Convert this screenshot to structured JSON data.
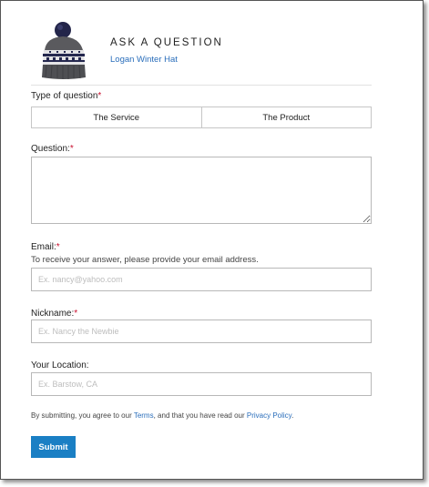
{
  "header": {
    "title": "ASK A QUESTION",
    "product_name": "Logan Winter Hat",
    "product_image": "winter-hat-image"
  },
  "question_type": {
    "label": "Type of question",
    "required_mark": "*",
    "options": [
      "The Service",
      "The Product"
    ]
  },
  "question": {
    "label": "Question:",
    "required_mark": "*",
    "value": ""
  },
  "email": {
    "label": "Email:",
    "required_mark": "*",
    "helper": "To receive your answer, please provide your email address.",
    "placeholder": "Ex. nancy@yahoo.com",
    "value": ""
  },
  "nickname": {
    "label": "Nickname:",
    "required_mark": "*",
    "placeholder": "Ex. Nancy the Newbie",
    "value": ""
  },
  "location": {
    "label": "Your Location:",
    "placeholder": "Ex. Barstow, CA",
    "value": ""
  },
  "legal": {
    "prefix": "By submitting, you agree to our ",
    "terms_link": "Terms",
    "middle": ", and that you have read our ",
    "privacy_link": "Privacy Policy",
    "suffix": "."
  },
  "submit_label": "Submit",
  "colors": {
    "accent": "#1a7fc4",
    "link": "#2a6ebb",
    "required": "#c8102e"
  }
}
